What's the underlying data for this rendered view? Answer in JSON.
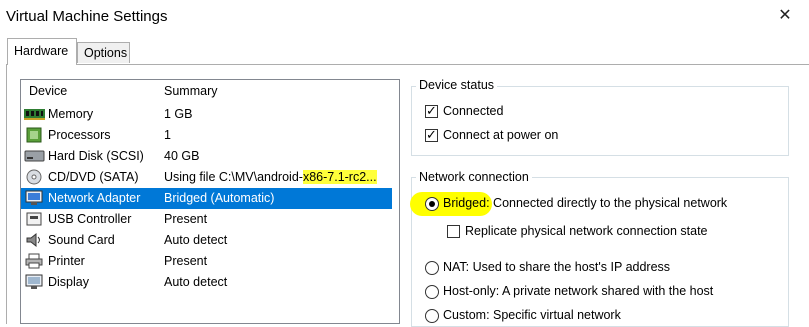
{
  "window": {
    "title": "Virtual Machine Settings",
    "close_glyph": "✕"
  },
  "tabs": [
    {
      "label": "Hardware",
      "active": true
    },
    {
      "label": "Options",
      "active": false
    }
  ],
  "device_list": {
    "columns": {
      "device": "Device",
      "summary": "Summary"
    },
    "rows": [
      {
        "icon": "memory-icon",
        "name": "Memory",
        "summary": "1 GB",
        "selected": false
      },
      {
        "icon": "processor-icon",
        "name": "Processors",
        "summary": "1",
        "selected": false
      },
      {
        "icon": "hard-disk-icon",
        "name": "Hard Disk (SCSI)",
        "summary": "40 GB",
        "selected": false
      },
      {
        "icon": "cd-dvd-icon",
        "name": "CD/DVD (SATA)",
        "summary_prefix": "Using file C:\\MV\\android-",
        "summary_highlight": "x86-7.1-rc2...",
        "selected": false
      },
      {
        "icon": "network-adapter-icon",
        "name": "Network Adapter",
        "summary": "Bridged (Automatic)",
        "selected": true
      },
      {
        "icon": "usb-controller-icon",
        "name": "USB Controller",
        "summary": "Present",
        "selected": false
      },
      {
        "icon": "sound-card-icon",
        "name": "Sound Card",
        "summary": "Auto detect",
        "selected": false
      },
      {
        "icon": "printer-icon",
        "name": "Printer",
        "summary": "Present",
        "selected": false
      },
      {
        "icon": "display-icon",
        "name": "Display",
        "summary": "Auto detect",
        "selected": false
      }
    ]
  },
  "device_status": {
    "title": "Device status",
    "connected": {
      "label": "Connected",
      "checked": true
    },
    "connect_at_power_on": {
      "label": "Connect at power on",
      "checked": true
    }
  },
  "network_connection": {
    "title": "Network connection",
    "bridged": {
      "label_highlight": "Bridged:",
      "label_rest": " Connected directly to the physical network",
      "selected": true
    },
    "replicate": {
      "label": "Replicate physical network connection state",
      "checked": false
    },
    "nat": {
      "label": "NAT: Used to share the host's IP address",
      "selected": false
    },
    "host_only": {
      "label": "Host-only: A private network shared with the host",
      "selected": false
    },
    "custom": {
      "label": "Custom: Specific virtual network",
      "selected": false
    }
  },
  "colors": {
    "selection": "#0078d7",
    "highlight": "#ffff00"
  }
}
